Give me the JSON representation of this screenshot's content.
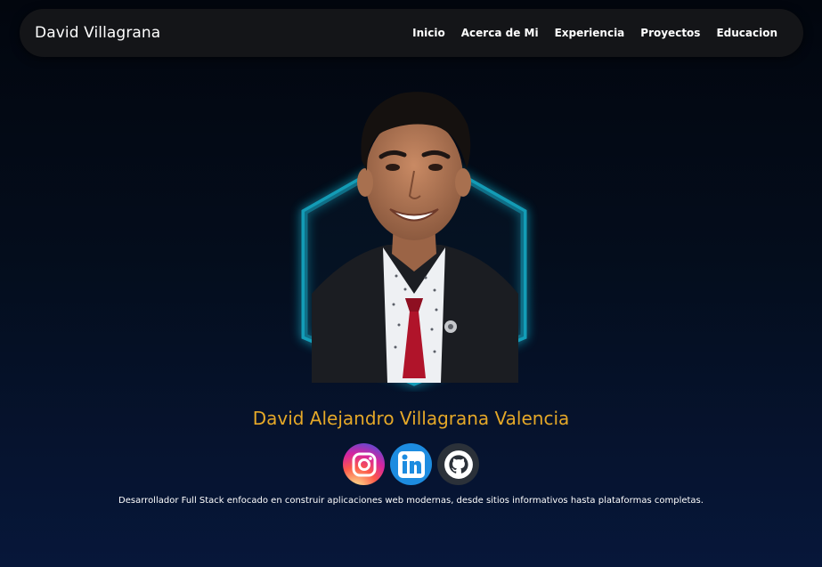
{
  "header": {
    "brand": "David Villagrana",
    "nav": [
      {
        "label": "Inicio"
      },
      {
        "label": "Acerca de Mi"
      },
      {
        "label": "Experiencia"
      },
      {
        "label": "Proyectos"
      },
      {
        "label": "Educacion"
      }
    ]
  },
  "hero": {
    "full_name": "David Alejandro Villagrana Valencia",
    "tagline": "Desarrollador Full Stack enfocado en construir aplicaciones web modernas, desde sitios informativos hasta plataformas completas.",
    "socials": [
      {
        "icon": "instagram-icon"
      },
      {
        "icon": "linkedin-icon"
      },
      {
        "icon": "github-icon"
      }
    ]
  },
  "colors": {
    "accent": "#e5a828",
    "hex_glow": "#19b6d2",
    "background_top": "#02060e",
    "background_bottom": "#07173a",
    "navbar": "#141518"
  }
}
